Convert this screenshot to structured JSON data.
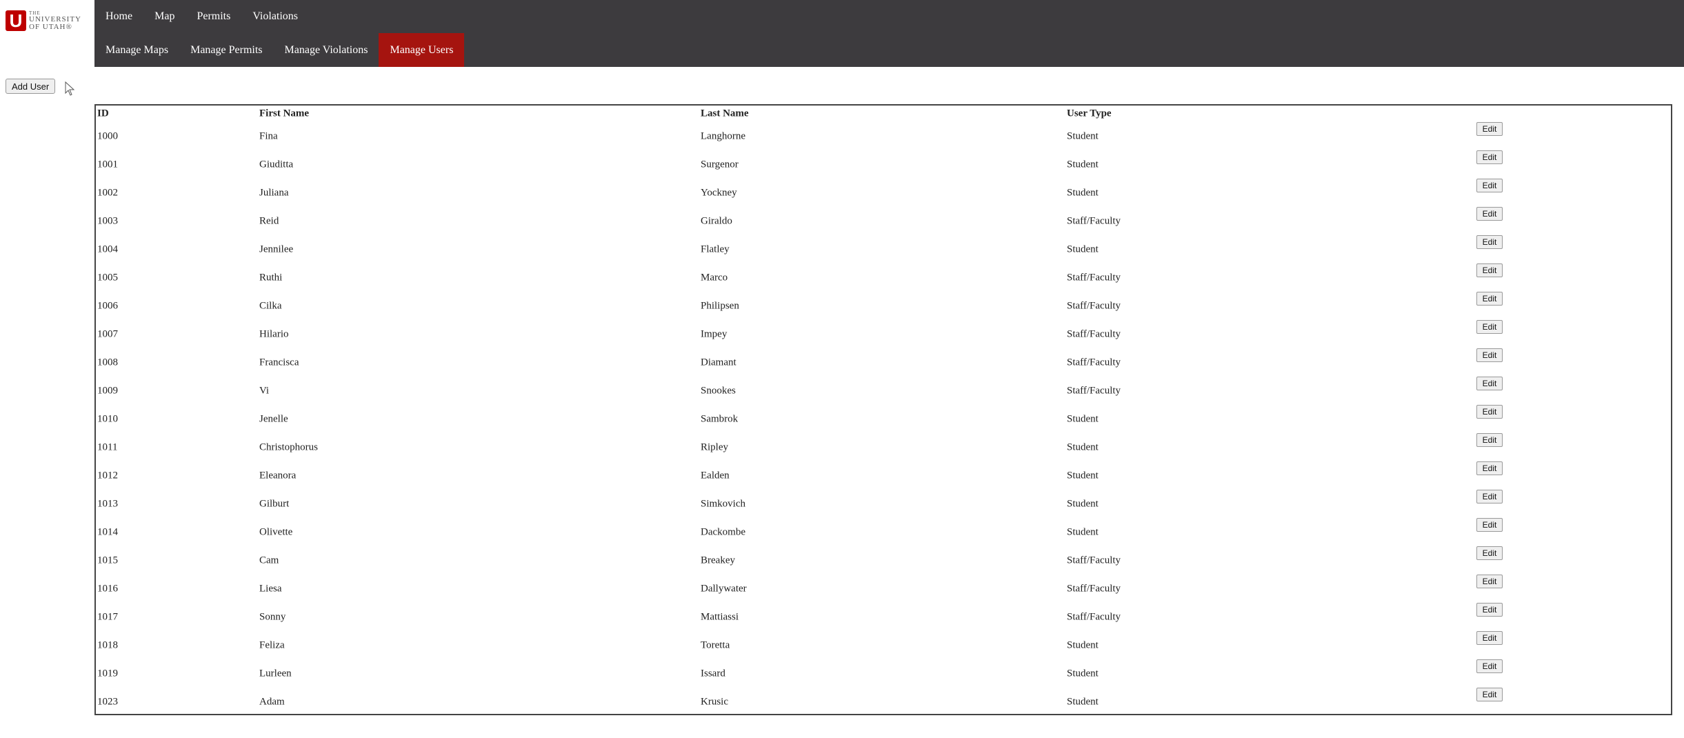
{
  "logo": {
    "mark": "U",
    "line1": "THE",
    "line2": "UNIVERSITY",
    "line3": "OF UTAH®"
  },
  "nav": {
    "top": [
      "Home",
      "Map",
      "Permits",
      "Violations"
    ],
    "sub": [
      "Manage Maps",
      "Manage Permits",
      "Manage Violations",
      "Manage Users"
    ],
    "active_sub": "Manage Users"
  },
  "add_user_label": "Add User",
  "table": {
    "headers": {
      "id": "ID",
      "first": "First Name",
      "last": "Last Name",
      "type": "User Type"
    },
    "edit_label": "Edit",
    "rows": [
      {
        "id": "1000",
        "first": "Fina",
        "last": "Langhorne",
        "type": "Student"
      },
      {
        "id": "1001",
        "first": "Giuditta",
        "last": "Surgenor",
        "type": "Student"
      },
      {
        "id": "1002",
        "first": "Juliana",
        "last": "Yockney",
        "type": "Student"
      },
      {
        "id": "1003",
        "first": "Reid",
        "last": "Giraldo",
        "type": "Staff/Faculty"
      },
      {
        "id": "1004",
        "first": "Jennilee",
        "last": "Flatley",
        "type": "Student"
      },
      {
        "id": "1005",
        "first": "Ruthi",
        "last": "Marco",
        "type": "Staff/Faculty"
      },
      {
        "id": "1006",
        "first": "Cilka",
        "last": "Philipsen",
        "type": "Staff/Faculty"
      },
      {
        "id": "1007",
        "first": "Hilario",
        "last": "Impey",
        "type": "Staff/Faculty"
      },
      {
        "id": "1008",
        "first": "Francisca",
        "last": "Diamant",
        "type": "Staff/Faculty"
      },
      {
        "id": "1009",
        "first": "Vi",
        "last": "Snookes",
        "type": "Staff/Faculty"
      },
      {
        "id": "1010",
        "first": "Jenelle",
        "last": "Sambrok",
        "type": "Student"
      },
      {
        "id": "1011",
        "first": "Christophorus",
        "last": "Ripley",
        "type": "Student"
      },
      {
        "id": "1012",
        "first": "Eleanora",
        "last": "Ealden",
        "type": "Student"
      },
      {
        "id": "1013",
        "first": "Gilburt",
        "last": "Simkovich",
        "type": "Student"
      },
      {
        "id": "1014",
        "first": "Olivette",
        "last": "Dackombe",
        "type": "Student"
      },
      {
        "id": "1015",
        "first": "Cam",
        "last": "Breakey",
        "type": "Staff/Faculty"
      },
      {
        "id": "1016",
        "first": "Liesa",
        "last": "Dallywater",
        "type": "Staff/Faculty"
      },
      {
        "id": "1017",
        "first": "Sonny",
        "last": "Mattiassi",
        "type": "Staff/Faculty"
      },
      {
        "id": "1018",
        "first": "Feliza",
        "last": "Toretta",
        "type": "Student"
      },
      {
        "id": "1019",
        "first": "Lurleen",
        "last": "Issard",
        "type": "Student"
      },
      {
        "id": "1023",
        "first": "Adam",
        "last": "Krusic",
        "type": "Student"
      }
    ]
  },
  "colors": {
    "navbar": "#3d3b3e",
    "active": "#a5140f",
    "logo": "#be0000"
  },
  "icons": {
    "cursor": "mouse-pointer-icon"
  }
}
